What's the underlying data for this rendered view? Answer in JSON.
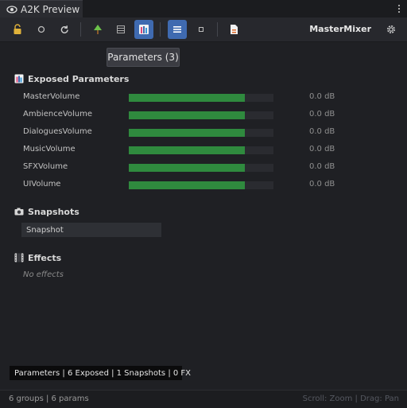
{
  "window": {
    "title": "A2K Preview"
  },
  "toolbar": {
    "mixer_name": "MasterMixer"
  },
  "tooltip": {
    "text": "Parameters (3)"
  },
  "exposed": {
    "heading": "Exposed Parameters",
    "params": [
      {
        "name": "MasterVolume",
        "value": "0.0 dB",
        "level": 0.8
      },
      {
        "name": "AmbienceVolume",
        "value": "0.0 dB",
        "level": 0.8
      },
      {
        "name": "DialoguesVolume",
        "value": "0.0 dB",
        "level": 0.8
      },
      {
        "name": "MusicVolume",
        "value": "0.0 dB",
        "level": 0.8
      },
      {
        "name": "SFXVolume",
        "value": "0.0 dB",
        "level": 0.8
      },
      {
        "name": "UIVolume",
        "value": "0.0 dB",
        "level": 0.8
      }
    ]
  },
  "snapshots": {
    "heading": "Snapshots",
    "items": [
      "Snapshot"
    ]
  },
  "effects": {
    "heading": "Effects",
    "empty_text": "No effects"
  },
  "statusline": {
    "text": "Parameters | 6 Exposed | 1 Snapshots | 0 FX"
  },
  "footer": {
    "left": "6 groups | 6 params",
    "right": "Scroll: Zoom | Drag: Pan"
  },
  "colors": {
    "accent": "#3f6ab0",
    "meter": "#2f8a3e",
    "background": "#1f2024"
  }
}
